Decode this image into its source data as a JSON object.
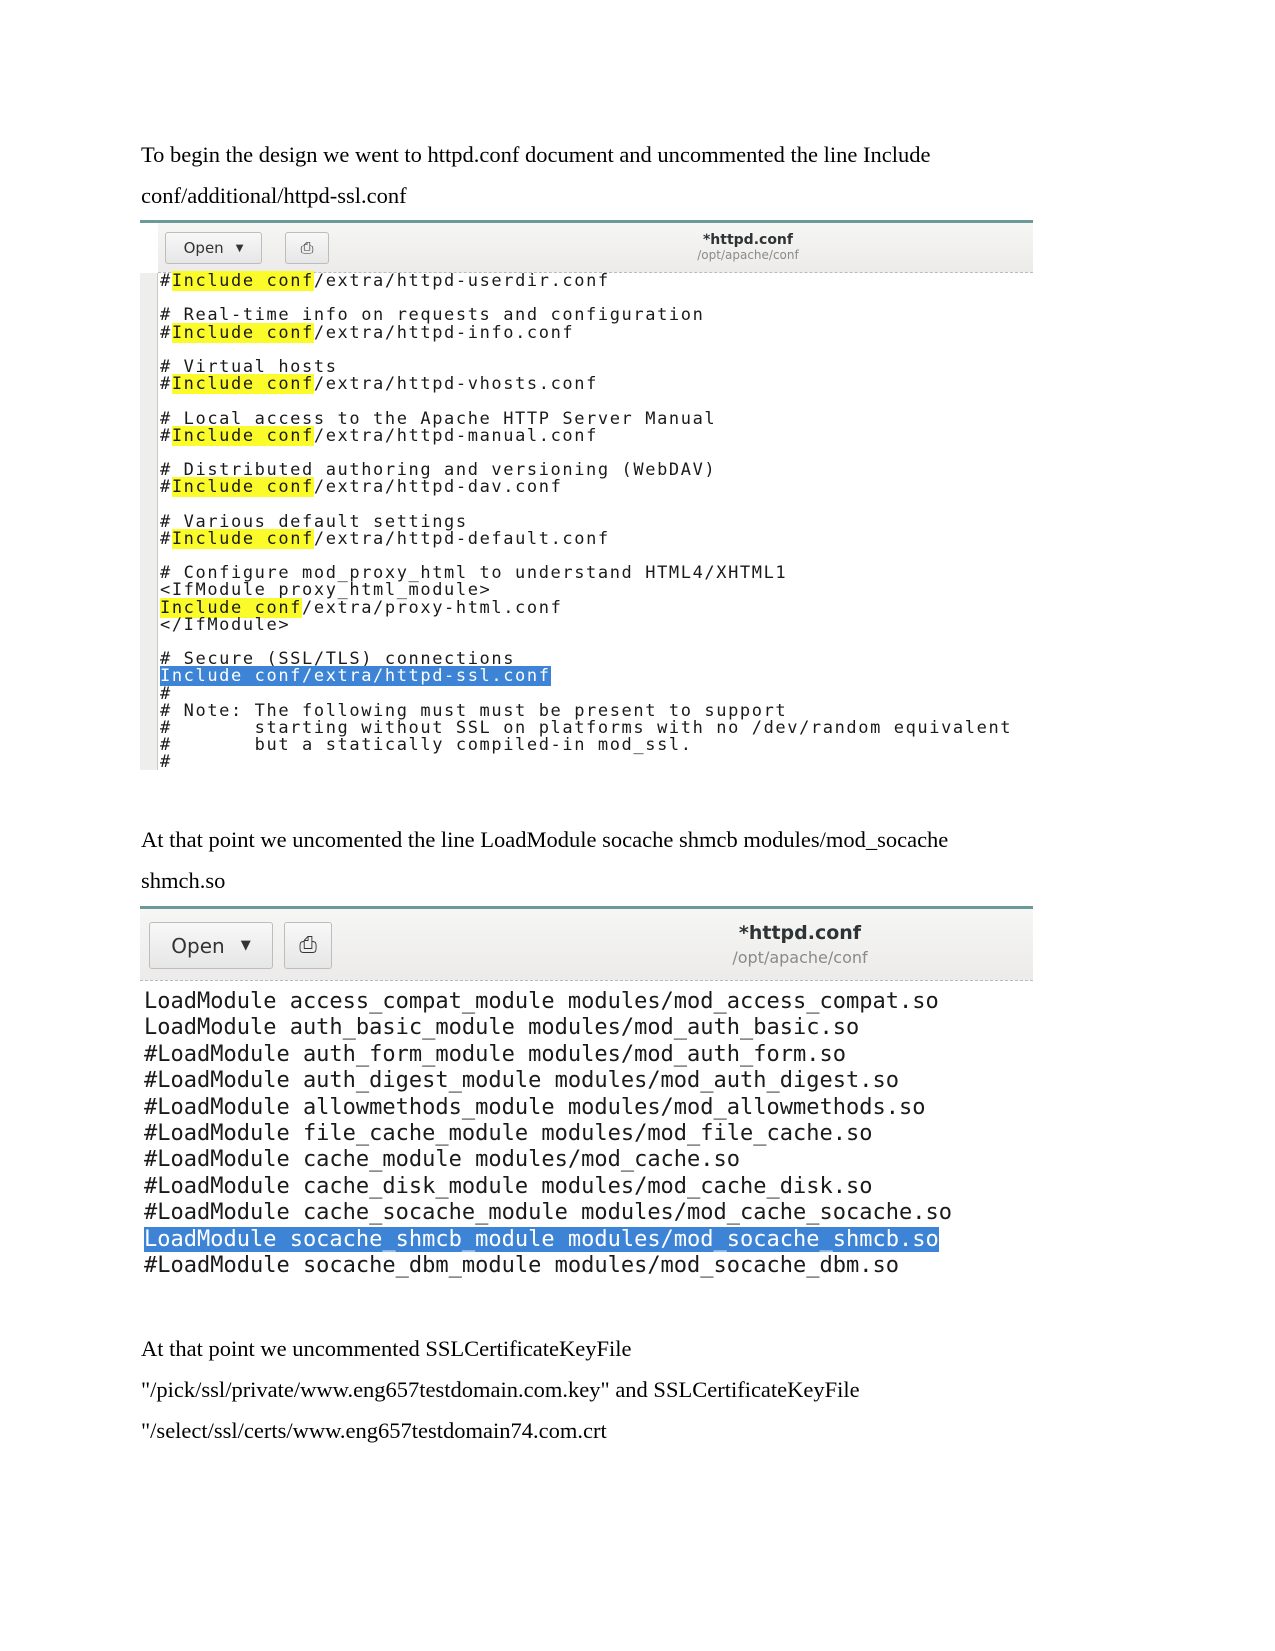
{
  "paragraphs": {
    "p1": "To begin the design we went to httpd.conf document and uncommented the line Include conf/additional/httpd-ssl.conf",
    "p2": "At that point we uncomented the line LoadModule socache shmcb modules/mod_socache shmch.so",
    "p3": "At that point we uncommented SSLCertificateKeyFile \"/pick/ssl/private/www.eng657testdomain.com.key\" and SSLCertificateKeyFile \"/select/ssl/certs/www.eng657testdomain74.com.crt"
  },
  "editor": {
    "open_label": "Open",
    "title": "*httpd.conf",
    "path": "/opt/apache/conf",
    "icons": {
      "open_dropdown": "chevron-down-icon",
      "save": "save-document-icon"
    },
    "highlight_color": "#fbfb2a",
    "selection_color": "#3d84d6"
  },
  "screenshot1": {
    "lines": [
      {
        "pre": "#",
        "hl": "Include conf",
        "post": "/extra/httpd-userdir.conf"
      },
      {
        "pre": ""
      },
      {
        "pre": "# Real-time info on requests and configuration"
      },
      {
        "pre": "#",
        "hl": "Include conf",
        "post": "/extra/httpd-info.conf"
      },
      {
        "pre": ""
      },
      {
        "pre": "# Virtual hosts"
      },
      {
        "pre": "#",
        "hl": "Include conf",
        "post": "/extra/httpd-vhosts.conf"
      },
      {
        "pre": ""
      },
      {
        "pre": "# Local access to the Apache HTTP Server Manual"
      },
      {
        "pre": "#",
        "hl": "Include conf",
        "post": "/extra/httpd-manual.conf"
      },
      {
        "pre": ""
      },
      {
        "pre": "# Distributed authoring and versioning (WebDAV)"
      },
      {
        "pre": "#",
        "hl": "Include conf",
        "post": "/extra/httpd-dav.conf"
      },
      {
        "pre": ""
      },
      {
        "pre": "# Various default settings"
      },
      {
        "pre": "#",
        "hl": "Include conf",
        "post": "/extra/httpd-default.conf"
      },
      {
        "pre": ""
      },
      {
        "pre": "# Configure mod_proxy_html to understand HTML4/XHTML1"
      },
      {
        "pre": "<IfModule proxy_html_module>"
      },
      {
        "pre": "",
        "hl": "Include conf",
        "post": "/extra/proxy-html.conf"
      },
      {
        "pre": "</IfModule>"
      },
      {
        "pre": ""
      },
      {
        "pre": "# Secure (SSL/TLS) connections"
      },
      {
        "pre": "",
        "sel": "Include conf/extra/httpd-ssl.conf"
      },
      {
        "pre": "#"
      },
      {
        "pre": "# Note: The following must must be present to support"
      },
      {
        "pre": "#       starting without SSL on platforms with no /dev/random equivalent"
      },
      {
        "pre": "#       but a statically compiled-in mod_ssl."
      },
      {
        "pre": "#"
      }
    ]
  },
  "screenshot2": {
    "lines": [
      {
        "pre": "LoadModule access_compat_module modules/mod_access_compat.so"
      },
      {
        "pre": "LoadModule auth_basic_module modules/mod_auth_basic.so"
      },
      {
        "pre": "#LoadModule auth_form_module modules/mod_auth_form.so"
      },
      {
        "pre": "#LoadModule auth_digest_module modules/mod_auth_digest.so"
      },
      {
        "pre": "#LoadModule allowmethods_module modules/mod_allowmethods.so"
      },
      {
        "pre": "#LoadModule file_cache_module modules/mod_file_cache.so"
      },
      {
        "pre": "#LoadModule cache_module modules/mod_cache.so"
      },
      {
        "pre": "#LoadModule cache_disk_module modules/mod_cache_disk.so"
      },
      {
        "pre": "#LoadModule cache_socache_module modules/mod_cache_socache.so"
      },
      {
        "pre": "",
        "sel": "LoadModule socache_shmcb_module modules/mod_socache_shmcb.so"
      },
      {
        "pre": "#LoadModule socache_dbm_module modules/mod_socache_dbm.so"
      }
    ]
  }
}
